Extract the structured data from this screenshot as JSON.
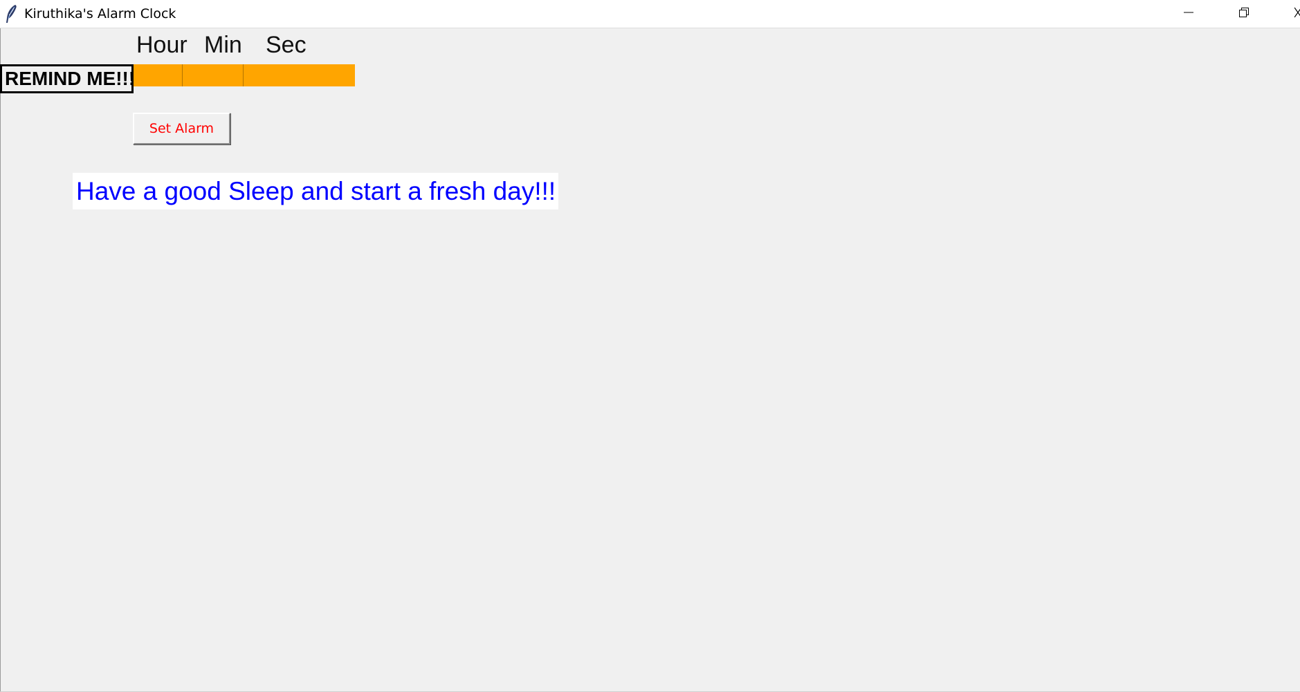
{
  "window": {
    "title": "Kiruthika's Alarm Clock",
    "icon": "feather-icon",
    "controls": {
      "minimize_icon": "minimize-icon",
      "restore_icon": "restore-icon",
      "close_icon": "close-icon"
    }
  },
  "form": {
    "headers": {
      "hour": "Hour",
      "min": "Min",
      "sec": "Sec"
    },
    "remind_label": "REMIND ME!!!",
    "fields": {
      "hour_value": "",
      "min_value": "",
      "sec_value": ""
    },
    "set_alarm_label": "Set Alarm",
    "message": "Have a good Sleep and start a fresh day!!!"
  },
  "colors": {
    "entry_bg": "#ffa500",
    "button_text": "#ff0000",
    "message_text": "#0000ff",
    "window_bg": "#f0f0f0"
  }
}
